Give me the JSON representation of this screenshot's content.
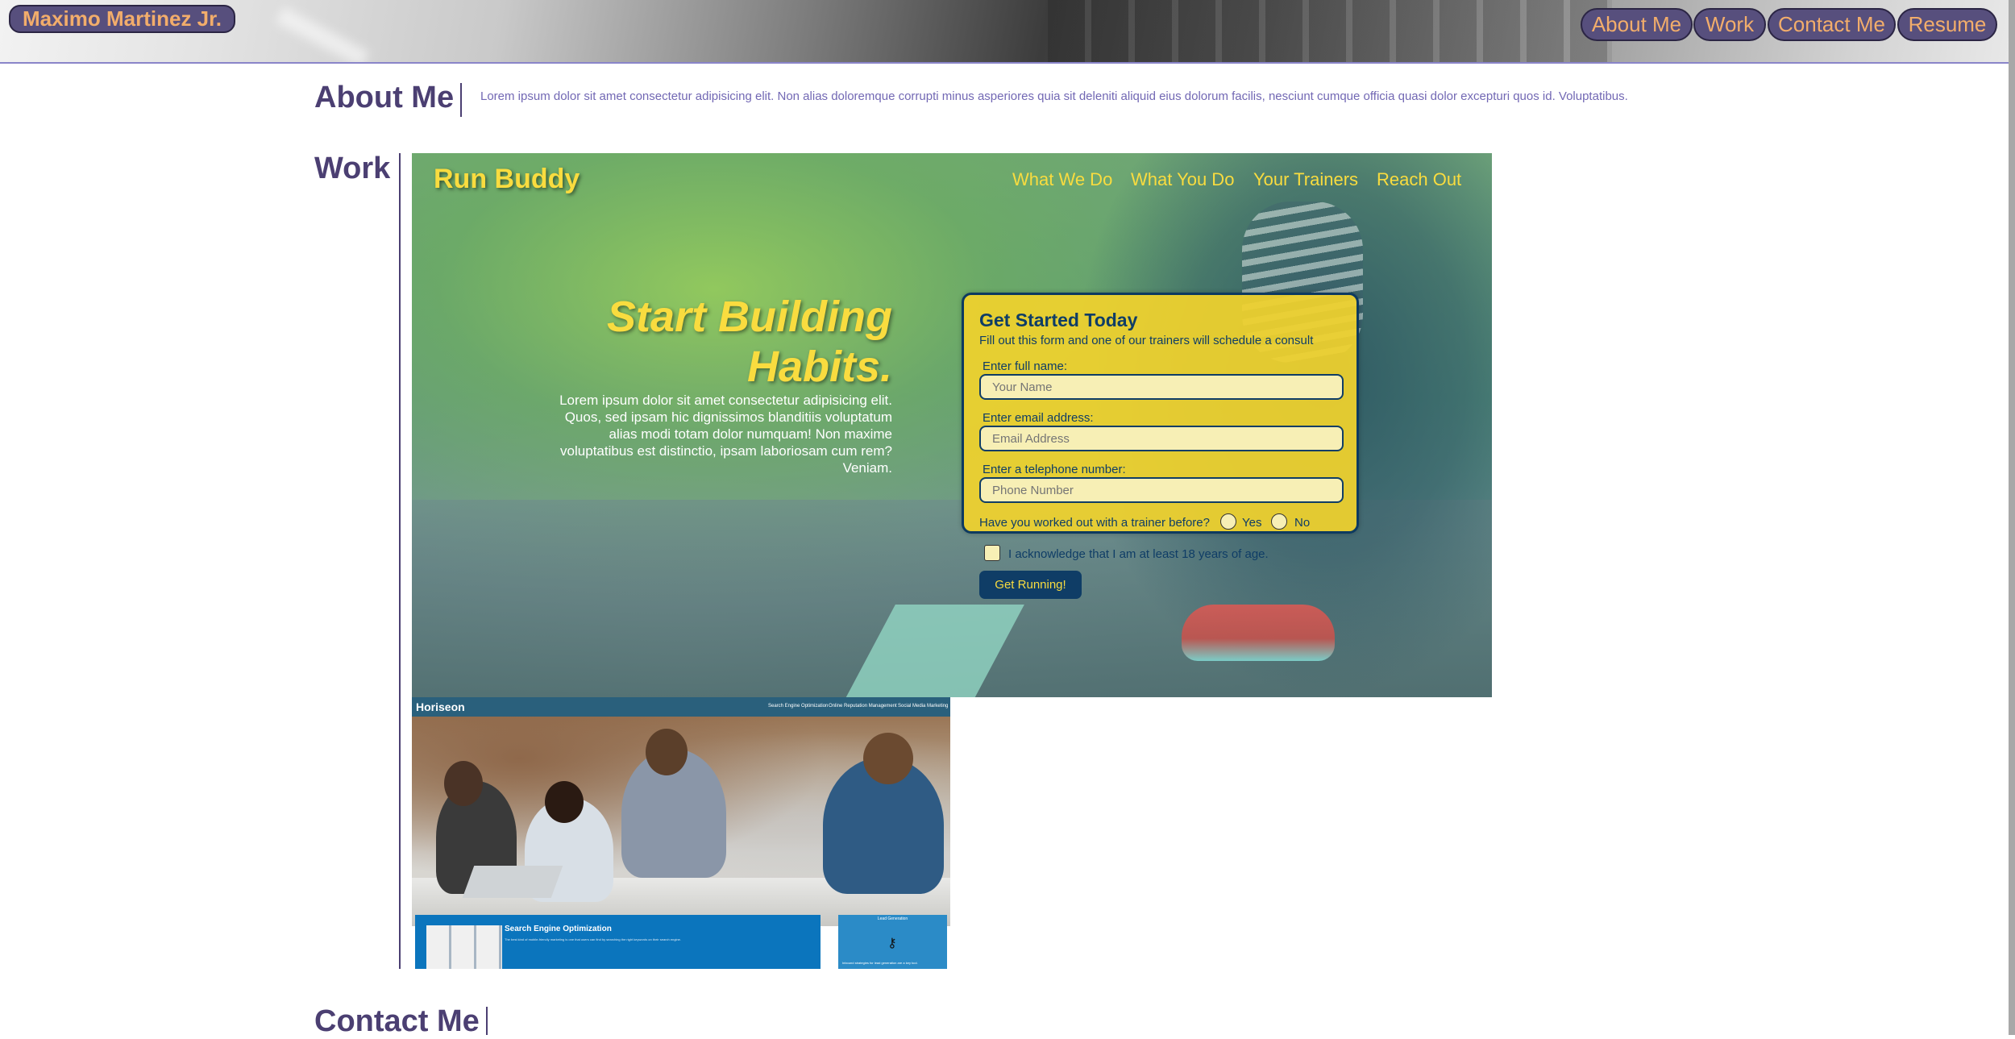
{
  "header": {
    "brand": "Maximo Martinez Jr.",
    "nav": [
      "About Me",
      "Work",
      "Contact Me",
      "Resume"
    ]
  },
  "about": {
    "title": "About Me",
    "text": "Lorem ipsum dolor sit amet consectetur adipisicing elit. Non alias doloremque corrupti minus asperiores quia sit deleniti aliquid eius dolorum facilis, nesciunt cumque officia quasi dolor excepturi quos id. Voluptatibus."
  },
  "work": {
    "title": "Work",
    "run_buddy": {
      "logo": "Run Buddy",
      "nav": [
        "What We Do",
        "What You Do",
        "Your Trainers",
        "Reach Out"
      ],
      "hero_title": "Start Building Habits.",
      "hero_text": "Lorem ipsum dolor sit amet consectetur adipisicing elit. Quos, sed ipsam hic dignissimos blanditiis voluptatum alias modi totam dolor numquam! Non maxime voluptatibus est distinctio, ipsam laboriosam cum rem? Veniam.",
      "form": {
        "title": "Get Started Today",
        "subtitle": "Fill out this form and one of our trainers will schedule a consult",
        "name_label": "Enter full name:",
        "name_placeholder": "Your Name",
        "email_label": "Enter email address:",
        "email_placeholder": "Email Address",
        "phone_label": "Enter a telephone number:",
        "phone_placeholder": "Phone Number",
        "question": "Have you worked out with a trainer before?",
        "yes": "Yes",
        "no": "No",
        "acknowledge": "I acknowledge that I am at least 18 years of age.",
        "submit": "Get Running!"
      }
    },
    "horiseon": {
      "logo": "Horiseon",
      "nav": [
        "Search Engine Optimization",
        "Online Reputation Management",
        "Social Media Marketing"
      ],
      "card_title": "Search Engine Optimization",
      "card_text": "The best kind of mobile-friendly marketing is one that users can find by searching the right keywords on their search engine.",
      "side_title": "Lead Generation",
      "side_text": "Inbound strategies for lead generation are a key tool."
    }
  },
  "contact": {
    "title": "Contact Me"
  },
  "colors": {
    "accent": "#f2ad6b",
    "pill": "#574f7d",
    "section_title": "#4b3f72",
    "runbuddy_yellow": "#f9dc3f",
    "runbuddy_navy": "#0f3d66"
  }
}
